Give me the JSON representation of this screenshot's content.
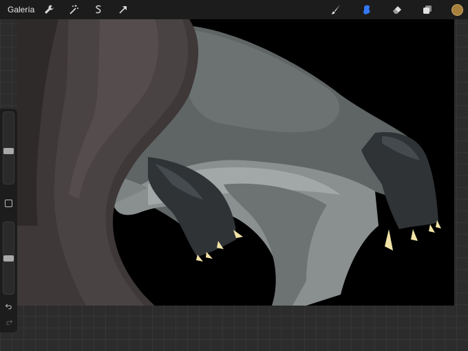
{
  "app": {
    "gallery_label": "Galería"
  },
  "toolbar": {
    "left_icons": [
      "wrench-icon",
      "magic-wand-icon",
      "selection-icon",
      "transform-arrow-icon"
    ],
    "right_icons": [
      "brush-icon",
      "smudge-icon",
      "eraser-icon",
      "layers-icon",
      "color-swatch-icon"
    ],
    "active_tool": "smudge",
    "active_color": "#a7803d",
    "accent_color": "#3478f6"
  },
  "sidebar": {
    "brush_size_level": 0.45,
    "opacity_level": 0.5,
    "icons": [
      "modify-square-icon",
      "undo-icon",
      "redo-icon"
    ]
  },
  "canvas": {
    "background": "#000000"
  }
}
